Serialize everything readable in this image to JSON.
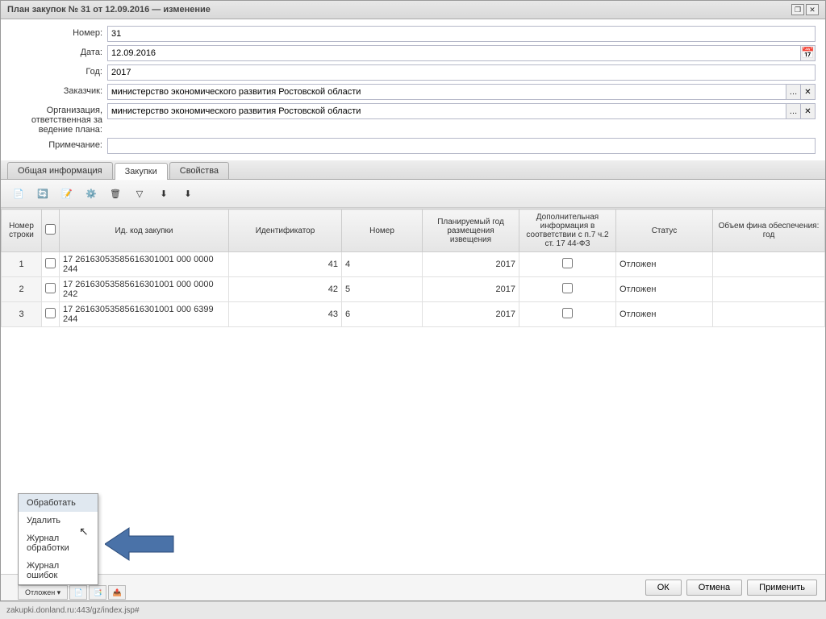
{
  "titlebar": {
    "title": "План закупок № 31 от 12.09.2016 — изменение"
  },
  "form": {
    "number": {
      "label": "Номер:",
      "value": "31"
    },
    "date": {
      "label": "Дата:",
      "value": "12.09.2016"
    },
    "year": {
      "label": "Год:",
      "value": "2017"
    },
    "customer": {
      "label": "Заказчик:",
      "value": "министерство экономического развития Ростовской области"
    },
    "org": {
      "label": "Организация, ответственная за ведение плана:",
      "value": "министерство экономического развития Ростовской области"
    },
    "note": {
      "label": "Примечание:",
      "value": ""
    }
  },
  "tabs": {
    "t1": "Общая информация",
    "t2": "Закупки",
    "t3": "Свойства"
  },
  "grid": {
    "headers": {
      "rownum": "Номер строки",
      "idcode": "Ид. код закупки",
      "identifier": "Идентификатор",
      "number": "Номер",
      "year": "Планируемый год размещения извещения",
      "extra": "Дополнительная информация в соответствии с п.7 ч.2 ст. 17 44-ФЗ",
      "status": "Статус",
      "amount": "Объем фина обеспечения: год"
    },
    "rows": [
      {
        "n": "1",
        "code": "17 26163053585616301001 000 0000 244",
        "id": "41",
        "num": "4",
        "year": "2017",
        "status": "Отложен"
      },
      {
        "n": "2",
        "code": "17 26163053585616301001 000 0000 242",
        "id": "42",
        "num": "5",
        "year": "2017",
        "status": "Отложен"
      },
      {
        "n": "3",
        "code": "17 26163053585616301001 000 6399 244",
        "id": "43",
        "num": "6",
        "year": "2017",
        "status": "Отложен"
      }
    ]
  },
  "context_menu": {
    "i1": "Обработать",
    "i2": "Удалить",
    "i3": "Журнал обработки",
    "i4": "Журнал ошибок"
  },
  "buttons": {
    "ok": "ОК",
    "cancel": "Отмена",
    "apply": "Применить"
  },
  "status": {
    "dropdown": "Отложен ▾",
    "url": "zakupki.donland.ru:443/gz/index.jsp#"
  }
}
